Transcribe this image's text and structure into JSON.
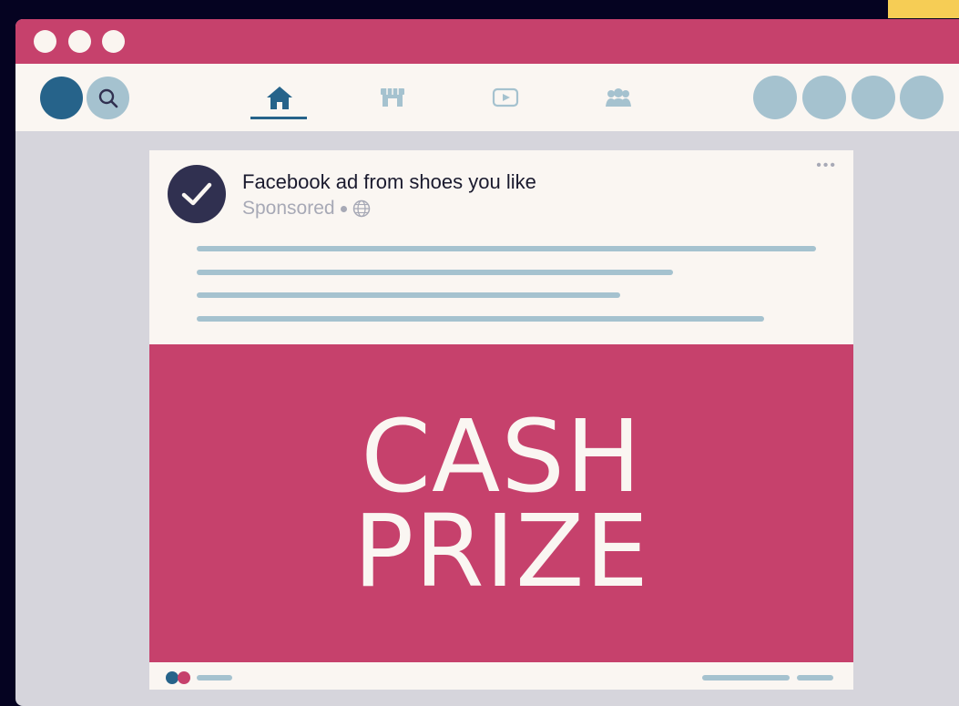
{
  "window": {
    "controls": [
      "close",
      "minimize",
      "maximize"
    ]
  },
  "navbar": {
    "tabs": [
      {
        "name": "home",
        "icon": "home-icon",
        "active": true
      },
      {
        "name": "marketplace",
        "icon": "store-icon",
        "active": false
      },
      {
        "name": "video",
        "icon": "video-icon",
        "active": false
      },
      {
        "name": "groups",
        "icon": "groups-icon",
        "active": false
      }
    ]
  },
  "post": {
    "title": "Facebook ad from shoes you like",
    "meta_label": "Sponsored",
    "more_label": "•••",
    "ad_line1": "CASH",
    "ad_line2": "PRIZE"
  },
  "colors": {
    "brand": "#c6416c",
    "accent": "#26638a",
    "placeholder": "#a5c2cf",
    "dark": "#303050",
    "highlight": "#f6cd55"
  }
}
